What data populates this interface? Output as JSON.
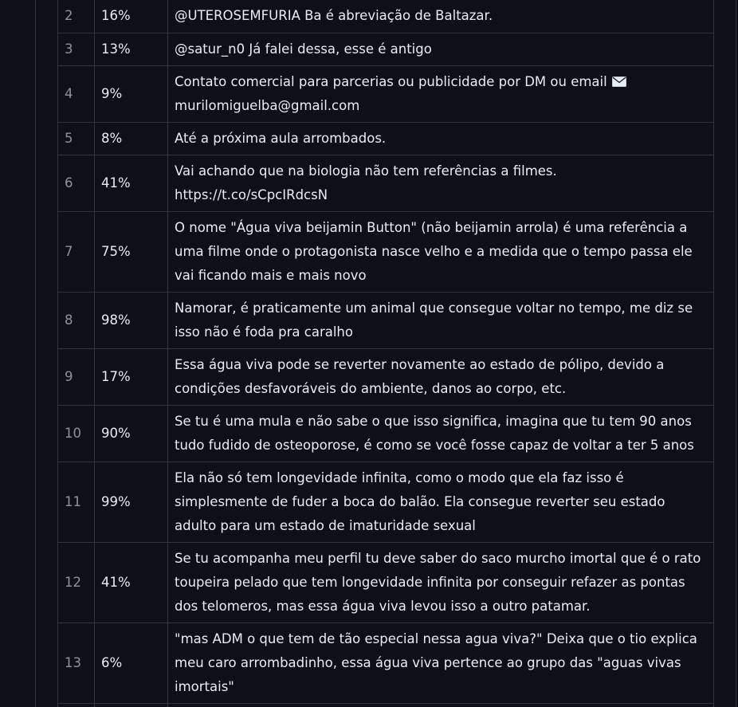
{
  "table": {
    "rows": [
      {
        "num": "2",
        "pct": "16%",
        "text": "@UTEROSEMFURIA Ba é abreviação de Baltazar."
      },
      {
        "num": "3",
        "pct": "13%",
        "text": "@satur_n0 Já falei dessa, esse é antigo"
      },
      {
        "num": "4",
        "pct": "9%",
        "text": "Contato comercial para parcerias ou publicidade por DM ou email",
        "icon": "envelope-icon",
        "text2": "murilomiguelba@gmail.com"
      },
      {
        "num": "5",
        "pct": "8%",
        "text": "Até a próxima aula arrombados."
      },
      {
        "num": "6",
        "pct": "41%",
        "text": "Vai achando que na biologia não tem referências a filmes. https://t.co/sCpcIRdcsN"
      },
      {
        "num": "7",
        "pct": "75%",
        "text": "O nome \"Água viva beijamin Button\" (não beijamin arrola) é uma referência a uma filme onde o protagonista nasce velho e a medida que o tempo passa ele vai ficando mais e mais novo"
      },
      {
        "num": "8",
        "pct": "98%",
        "text": "Namorar, é praticamente um animal que consegue voltar no tempo, me diz se isso não é foda pra caralho"
      },
      {
        "num": "9",
        "pct": "17%",
        "text": "Essa água viva pode se reverter novamente ao estado de pólipo, devido a condições desfavoráveis do ambiente, danos ao corpo, etc."
      },
      {
        "num": "10",
        "pct": "90%",
        "text": "Se tu é uma mula e não sabe o que isso significa, imagina que tu tem 90 anos tudo fudido de osteoporose, é como se você fosse capaz de voltar a ter 5 anos"
      },
      {
        "num": "11",
        "pct": "99%",
        "text": "Ela não só tem longevidade infinita, como o modo que ela faz isso é simplesmente de fuder a boca do balão. Ela consegue reverter seu estado adulto para um estado de imaturidade sexual"
      },
      {
        "num": "12",
        "pct": "41%",
        "text": "Se tu acompanha meu perfil tu deve saber do saco murcho imortal que é o rato toupeira pelado que tem longevidade infinita por conseguir refazer as pontas dos telomeros, mas essa água viva levou isso a outro patamar."
      },
      {
        "num": "13",
        "pct": "6%",
        "text": "\"mas ADM o que tem de tão especial nessa agua viva?\" Deixa que o tio explica meu caro arrombadinho, essa água viva pertence ao grupo das \"aguas vivas imortais\""
      }
    ]
  }
}
